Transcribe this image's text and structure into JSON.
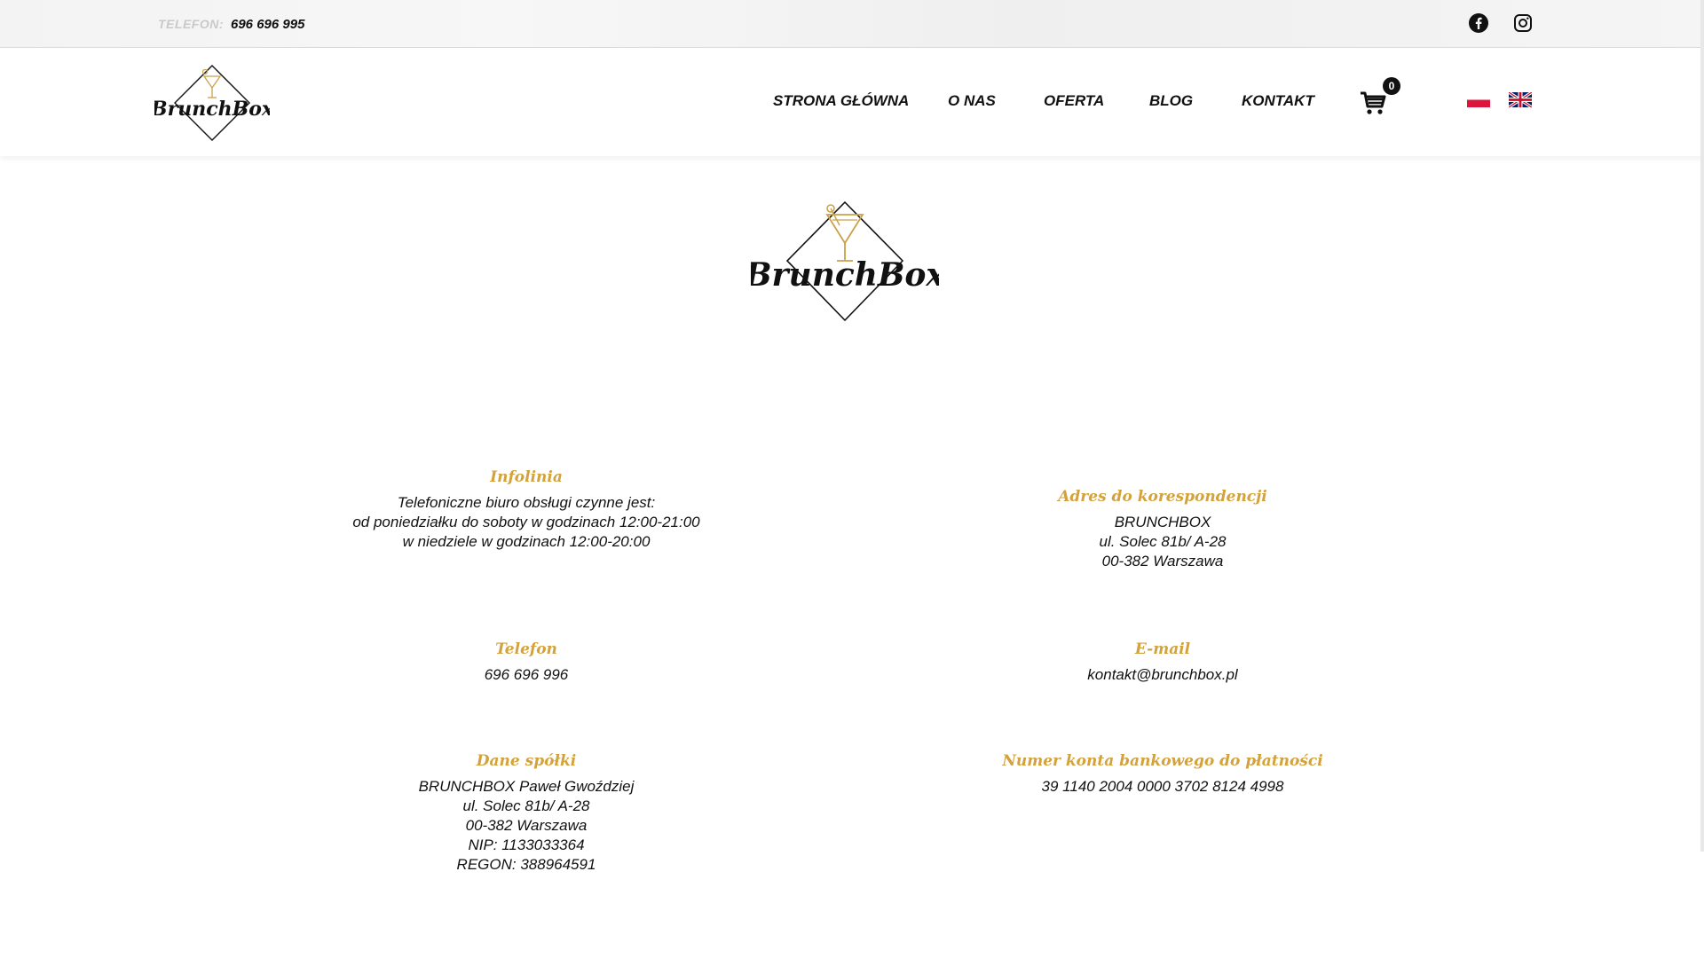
{
  "topbar": {
    "phone_label": "TELEFON:",
    "phone_value": "696 696 995",
    "social": [
      "facebook-icon",
      "instagram-icon"
    ]
  },
  "header": {
    "logo_text": "BrunchBox",
    "nav": [
      "STRONA GŁÓWNA",
      "O NAS",
      "OFERTA",
      "BLOG",
      "KONTAKT"
    ],
    "cart_count": "0",
    "languages": [
      "pl",
      "en"
    ]
  },
  "main": {
    "logo_text": "BrunchBox",
    "infolinia": {
      "title": "Infolinia",
      "lines": [
        "Telefoniczne biuro obsługi czynne jest:",
        "od poniedziałku do soboty w godzinach 12:00-21:00",
        "w niedziele w godzinach 12:00-20:00"
      ]
    },
    "adres": {
      "title": "Adres do korespondencji",
      "lines": [
        "BRUNCHBOX",
        "ul. Solec 81b/ A-28",
        "00-382 Warszawa"
      ]
    },
    "telefon": {
      "title": "Telefon",
      "lines": [
        "696 696 996"
      ]
    },
    "email": {
      "title": "E-mail",
      "lines": [
        "kontakt@brunchbox.pl"
      ]
    },
    "spolka": {
      "title": "Dane spółki",
      "lines": [
        "BRUNCHBOX Paweł Gwoździej",
        "ul. Solec 81b/ A-28",
        "00-382 Warszawa",
        "NIP: 1133033364",
        "REGON: 388964591"
      ]
    },
    "konto": {
      "title": "Numer konta bankowego do płatności",
      "lines": [
        "39 1140 2004 0000 3702 8124 4998"
      ]
    }
  },
  "colors": {
    "accent": "#d4a23a",
    "text": "#111111"
  }
}
